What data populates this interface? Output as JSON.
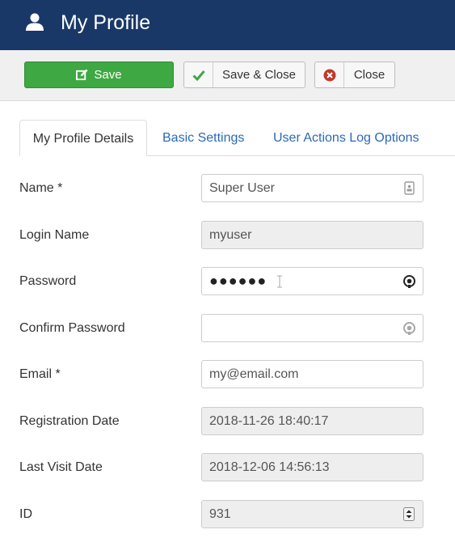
{
  "header": {
    "title": "My Profile"
  },
  "toolbar": {
    "save": "Save",
    "save_close": "Save & Close",
    "close": "Close"
  },
  "tabs": [
    {
      "label": "My Profile Details",
      "active": true
    },
    {
      "label": "Basic Settings",
      "active": false
    },
    {
      "label": "User Actions Log Options",
      "active": false
    }
  ],
  "form": {
    "name": {
      "label": "Name *",
      "value": "Super User"
    },
    "login": {
      "label": "Login Name",
      "value": "myuser"
    },
    "password": {
      "label": "Password",
      "value": "●●●●●●"
    },
    "confirm": {
      "label": "Confirm Password",
      "value": ""
    },
    "email": {
      "label": "Email *",
      "value": "my@email.com"
    },
    "registration": {
      "label": "Registration Date",
      "value": "2018-11-26 18:40:17"
    },
    "last_visit": {
      "label": "Last Visit Date",
      "value": "2018-12-06 14:56:13"
    },
    "id": {
      "label": "ID",
      "value": "931"
    }
  },
  "colors": {
    "header_bg": "#1a3867",
    "save_green": "#3ea843",
    "link_blue": "#2a69b8",
    "close_red": "#c0392b"
  }
}
